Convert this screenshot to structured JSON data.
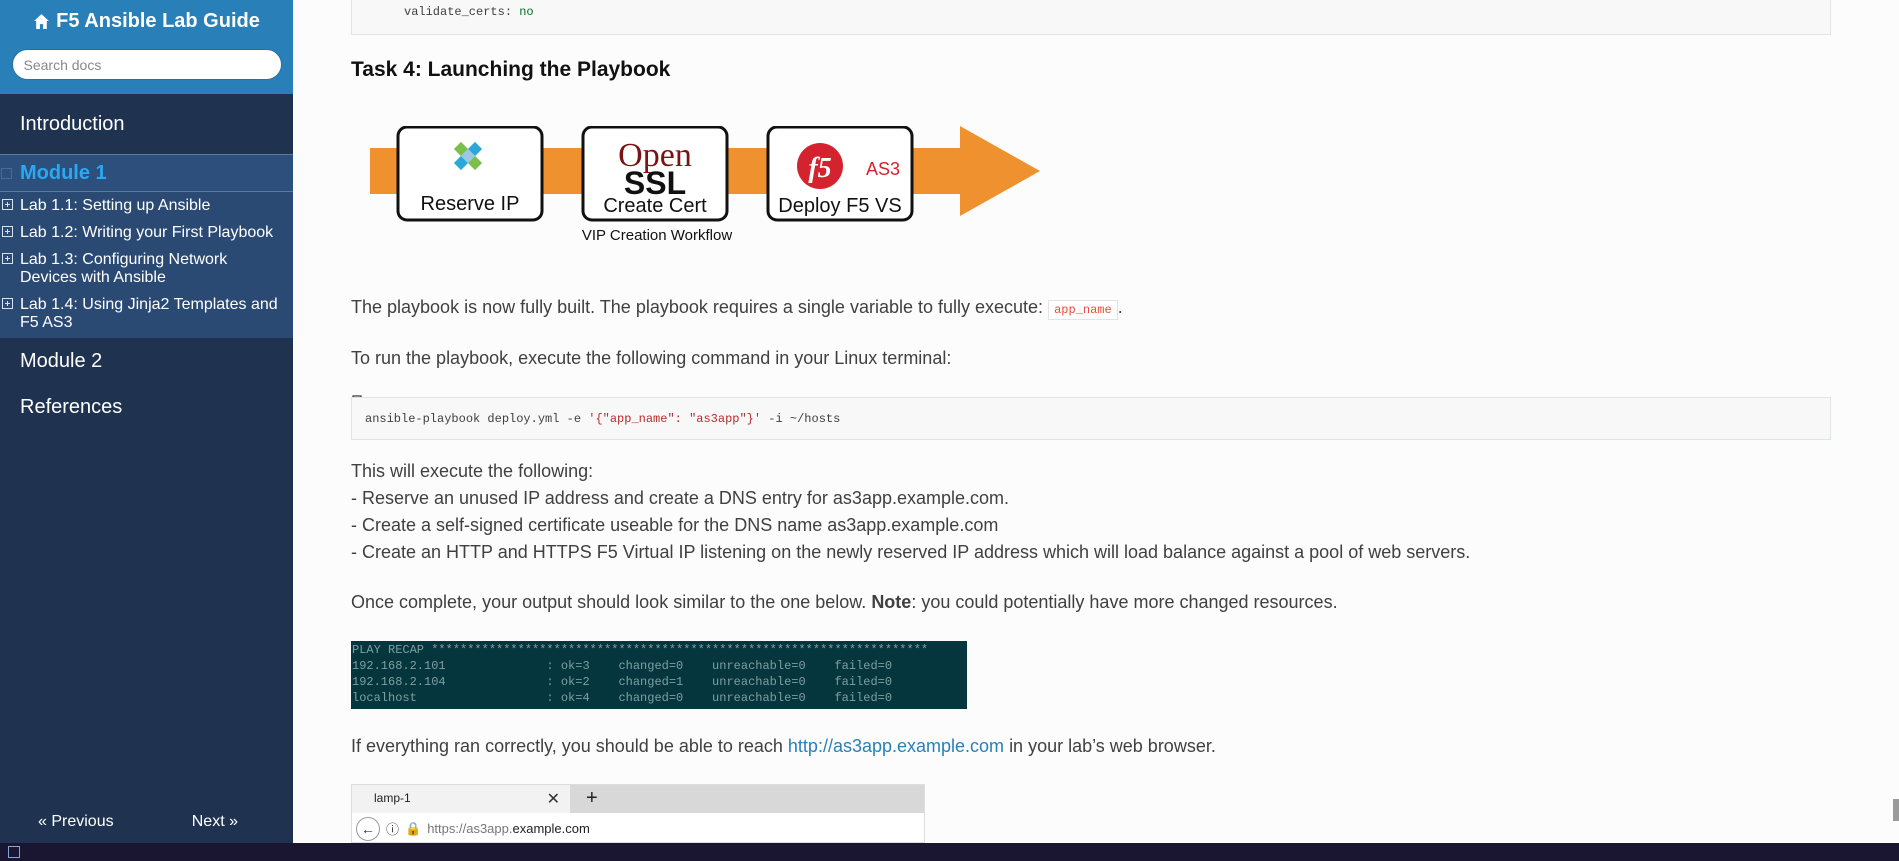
{
  "sidebar": {
    "brand": "F5 Ansible Lab Guide",
    "search_placeholder": "Search docs",
    "nav": [
      {
        "label": "Introduction"
      },
      {
        "label": "Module 1"
      },
      {
        "label": "Module 2"
      },
      {
        "label": "References"
      }
    ],
    "sub_items": [
      {
        "label": "Lab 1.1: Setting up Ansible"
      },
      {
        "label": "Lab 1.2: Writing your First Playbook"
      },
      {
        "label": "Lab 1.3: Configuring Network Devices with Ansible"
      },
      {
        "label": "Lab 1.4: Using Jinja2 Templates and F5 AS3"
      }
    ],
    "previous": "« Previous",
    "next": "Next »"
  },
  "content": {
    "code_top": {
      "key": "validate_certs:",
      "value": "no"
    },
    "heading": "Task 4: Launching the Playbook",
    "diagram": {
      "box1_label": "Reserve IP",
      "box2_top": "Open",
      "box2_mid": "SSL",
      "box2_label": "Create Cert",
      "box3_logo": "f5",
      "box3_badge": "AS3",
      "box3_label": "Deploy F5 VS",
      "caption": "VIP Creation Workflow"
    },
    "p1_text": "The playbook is now fully built. The playbook requires a single variable to fully execute:",
    "p1_code": "app_name",
    "p1_end": ".",
    "p2": "To run the playbook, execute the following command in your Linux terminal:",
    "command": {
      "prefix": "ansible-playbook deploy.yml -e ",
      "arg": "'{\"app_name\": \"as3app\"}'",
      "suffix": " -i ~/hosts"
    },
    "p3_lines": [
      "This will execute the following:",
      "- Reserve an unused IP address and create a DNS entry for as3app.example.com.",
      "- Create a self-signed certificate useable for the DNS name as3app.example.com",
      "- Create an HTTP and HTTPS F5 Virtual IP listening on the newly reserved IP address which will load balance against a pool of web servers."
    ],
    "p4_text": "Once complete, your output should look similar to the one below.",
    "p4_bold": "Note",
    "p4_rest": ": you could potentially have more changed resources.",
    "recap_lines": [
      "PLAY RECAP *********************************************************************",
      "192.168.2.101              : ok=3    changed=0    unreachable=0    failed=0",
      "192.168.2.104              : ok=2    changed=1    unreachable=0    failed=0",
      "localhost                  : ok=4    changed=0    unreachable=0    failed=0"
    ],
    "p5_text": "If everything ran correctly, you should be able to reach",
    "p5_link": "http://as3app.example.com",
    "p5_rest": "in your lab’s web browser.",
    "browser": {
      "tab_label": "lamp-1",
      "url_prefix": "https://as3app.",
      "url_domain": "example.com"
    }
  },
  "colors": {
    "sidebar_top": "#2980b9",
    "sidebar_bg": "#1f3350",
    "current_item": "#2aa8f2",
    "link": "#2980b9",
    "arrow": "#f0912f",
    "terminal_bg": "#06363d"
  }
}
